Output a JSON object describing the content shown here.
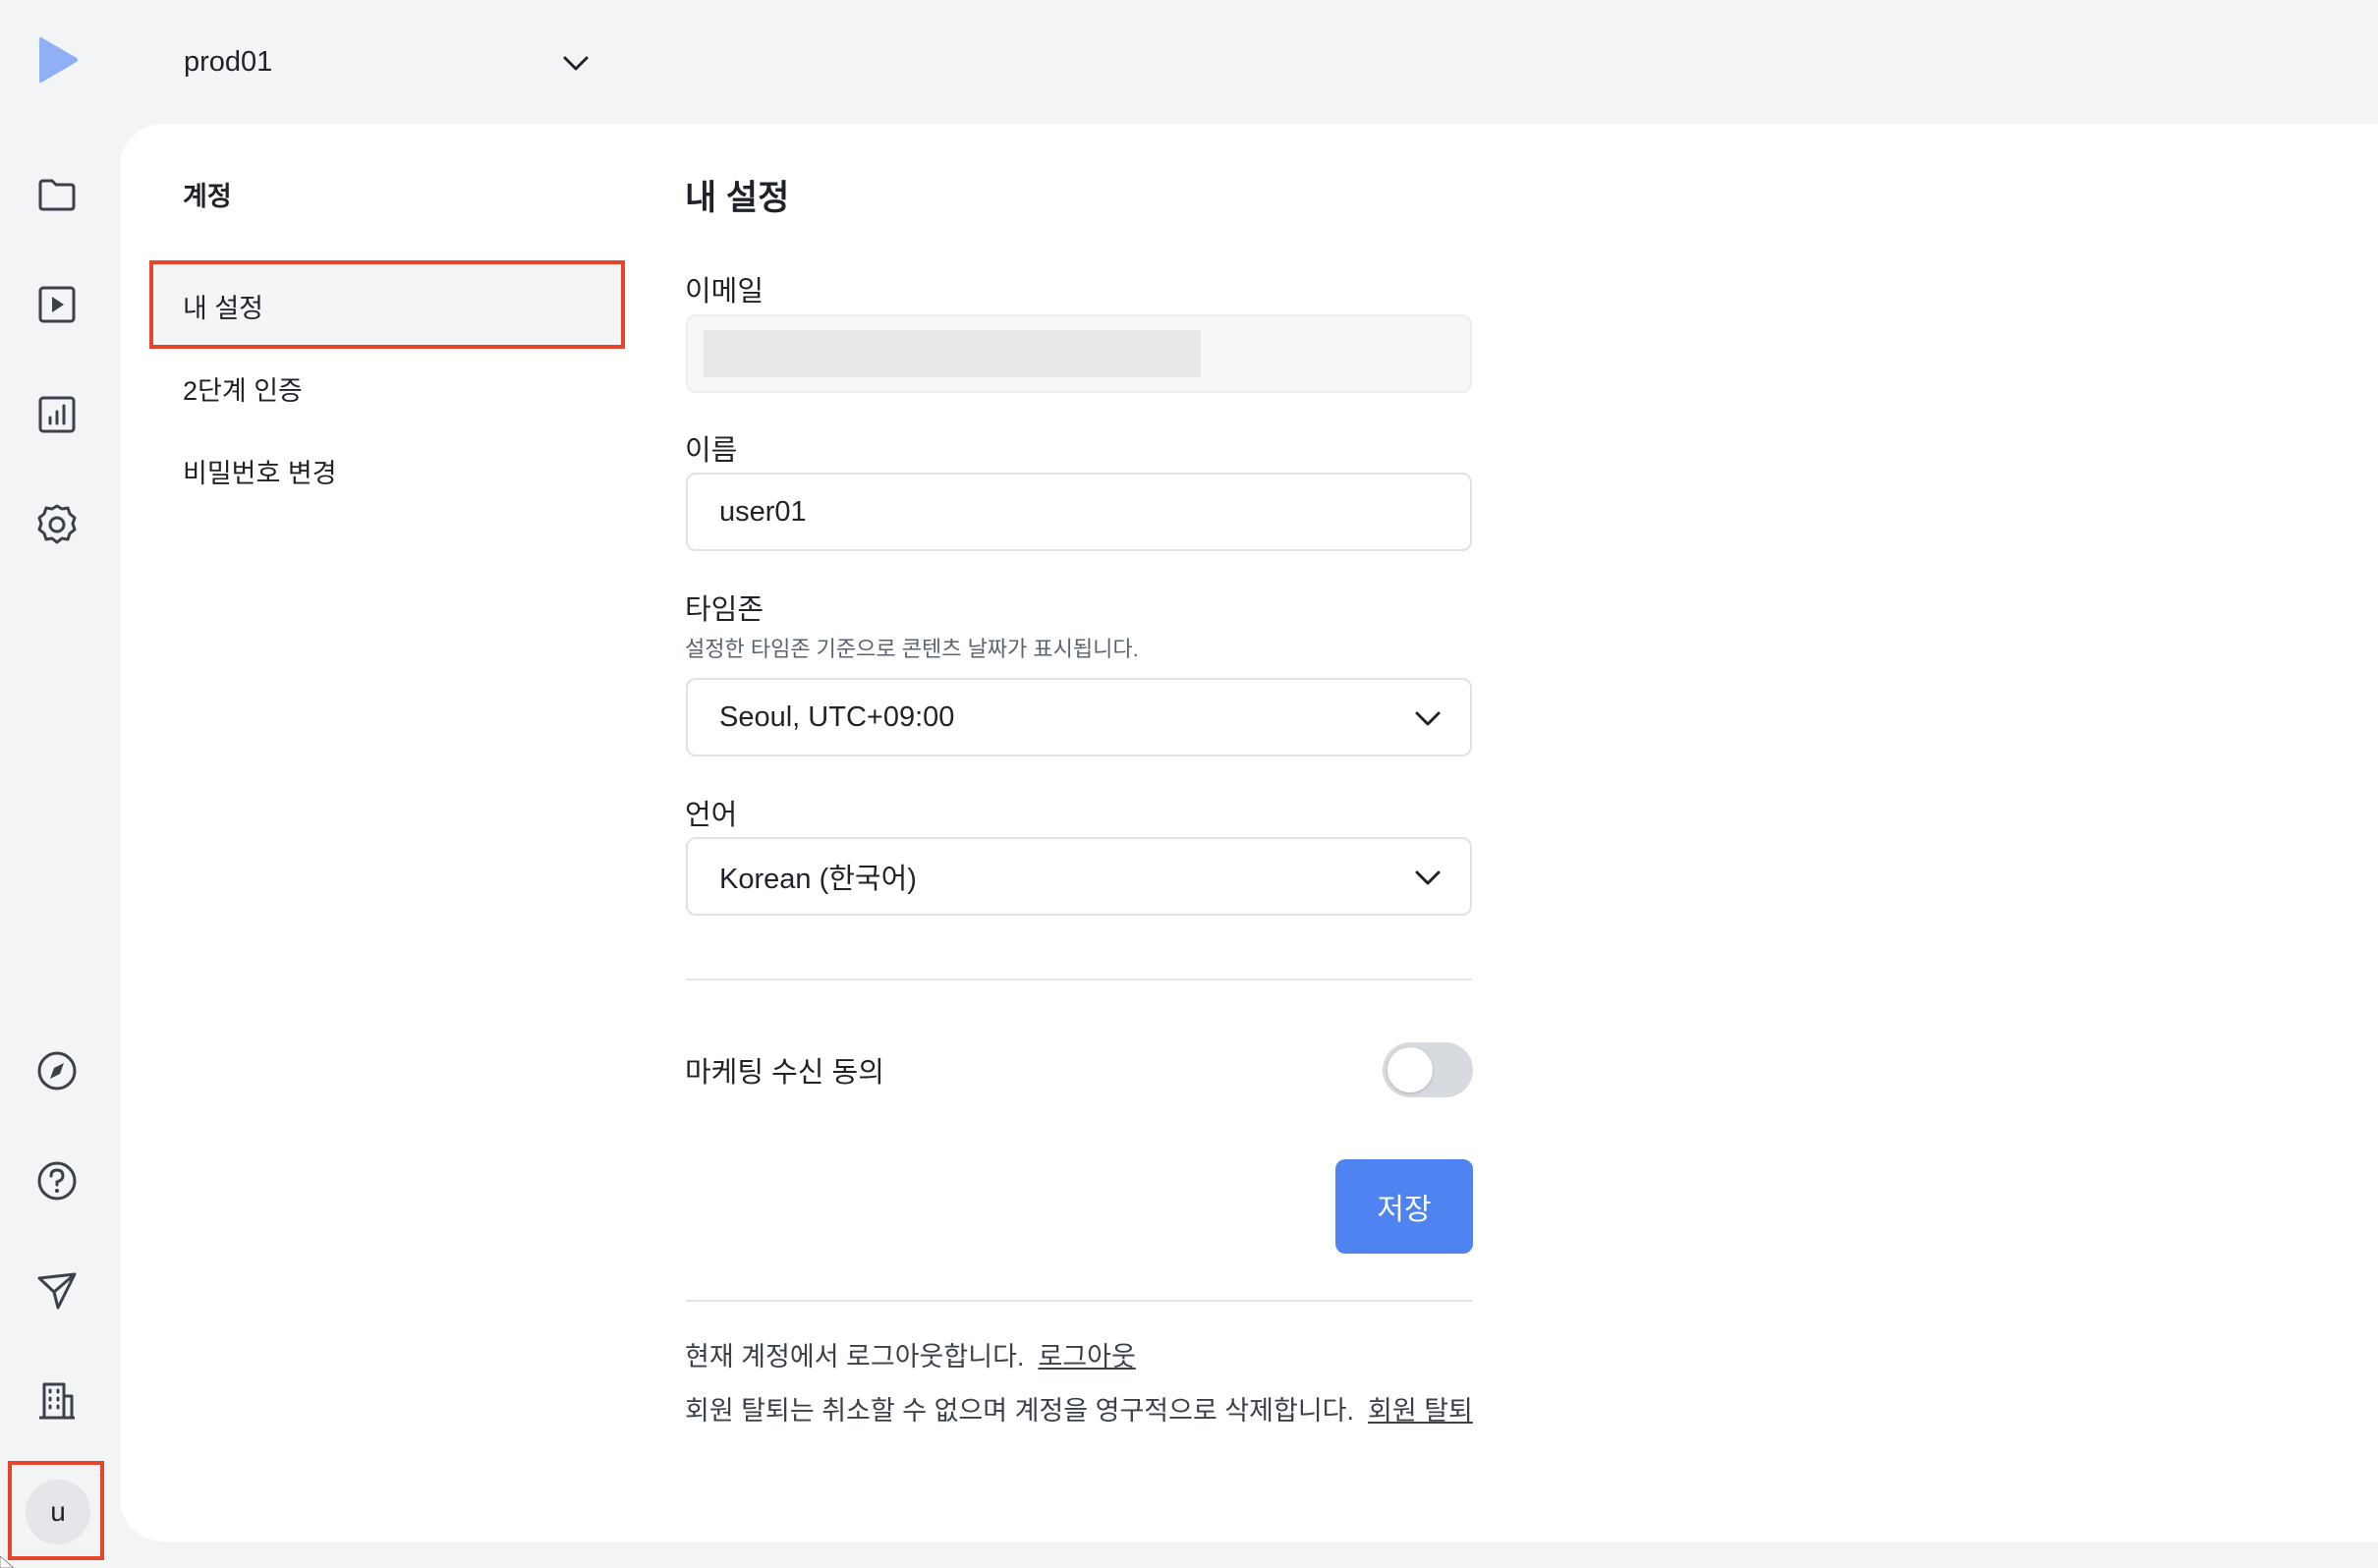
{
  "workspace": {
    "name": "prod01"
  },
  "rail": {
    "top_icons": [
      "folder-icon",
      "play-square-icon",
      "bar-chart-icon",
      "settings-icon"
    ],
    "bottom_icons": [
      "compass-icon",
      "help-circle-icon",
      "send-icon",
      "building-icon"
    ],
    "avatar_initial": "u"
  },
  "sidebar": {
    "title": "계정",
    "items": [
      {
        "label": "내 설정",
        "active": true
      },
      {
        "label": "2단계 인증",
        "active": false
      },
      {
        "label": "비밀번호 변경",
        "active": false
      }
    ]
  },
  "main": {
    "title": "내 설정",
    "email": {
      "label": "이메일",
      "value": ""
    },
    "name": {
      "label": "이름",
      "value": "user01"
    },
    "timezone": {
      "label": "타임존",
      "hint": "설정한 타임존 기준으로 콘텐츠 날짜가 표시됩니다.",
      "value": "Seoul, UTC+09:00"
    },
    "language": {
      "label": "언어",
      "value": "Korean (한국어)"
    },
    "marketing": {
      "label": "마케팅 수신 동의",
      "enabled": false
    },
    "save_label": "저장",
    "logout": {
      "text": "현재 계정에서 로그아웃합니다.",
      "link": "로그아웃"
    },
    "withdraw": {
      "text": "회원 탈퇴는 취소할 수 없으며 계정을 영구적으로 삭제합니다.",
      "link": "회원 탈퇴"
    }
  },
  "colors": {
    "accent": "#4f83f1",
    "highlight": "#e5452b",
    "logo": "#8fb0f5"
  }
}
